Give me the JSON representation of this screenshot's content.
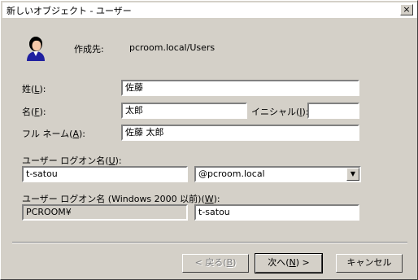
{
  "window": {
    "title": "新しいオブジェクト - ユーザー",
    "close_glyph": "×"
  },
  "header": {
    "created_in_label": "作成先:",
    "created_in_value": "pcroom.local/Users"
  },
  "form": {
    "last_name": {
      "label": "姓(",
      "key": "L",
      "label_end": "):",
      "value": "佐藤"
    },
    "first_name": {
      "label": "名(",
      "key": "F",
      "label_end": "):",
      "value": "太郎"
    },
    "initials": {
      "label": "イニシャル(",
      "key": "I",
      "label_end": "):",
      "value": ""
    },
    "full_name": {
      "label": "フル ネーム(",
      "key": "A",
      "label_end": "):",
      "value": "佐藤 太郎"
    },
    "logon_name": {
      "label": "ユーザー ログオン名(",
      "key": "U",
      "label_end": "):",
      "value": "t-satou",
      "domain_selected": "@pcroom.local"
    },
    "logon_name_pre2000": {
      "label": "ユーザー ログオン名 (Windows 2000 以前)(",
      "key": "W",
      "label_end": "):",
      "domain_value": "PCROOM¥",
      "value": "t-satou"
    }
  },
  "buttons": {
    "back": {
      "label": "< 戻る(",
      "key": "B",
      "label_end": ")"
    },
    "next": {
      "label": "次へ(",
      "key": "N",
      "label_end": ") >"
    },
    "cancel": {
      "label": "キャンセル"
    }
  },
  "colors": {
    "face": "#d4d0c8",
    "shadow": "#808080",
    "highlight": "#ffffff"
  },
  "icons": {
    "avatar": "user-avatar-icon",
    "dropdown": "chevron-down-icon"
  }
}
